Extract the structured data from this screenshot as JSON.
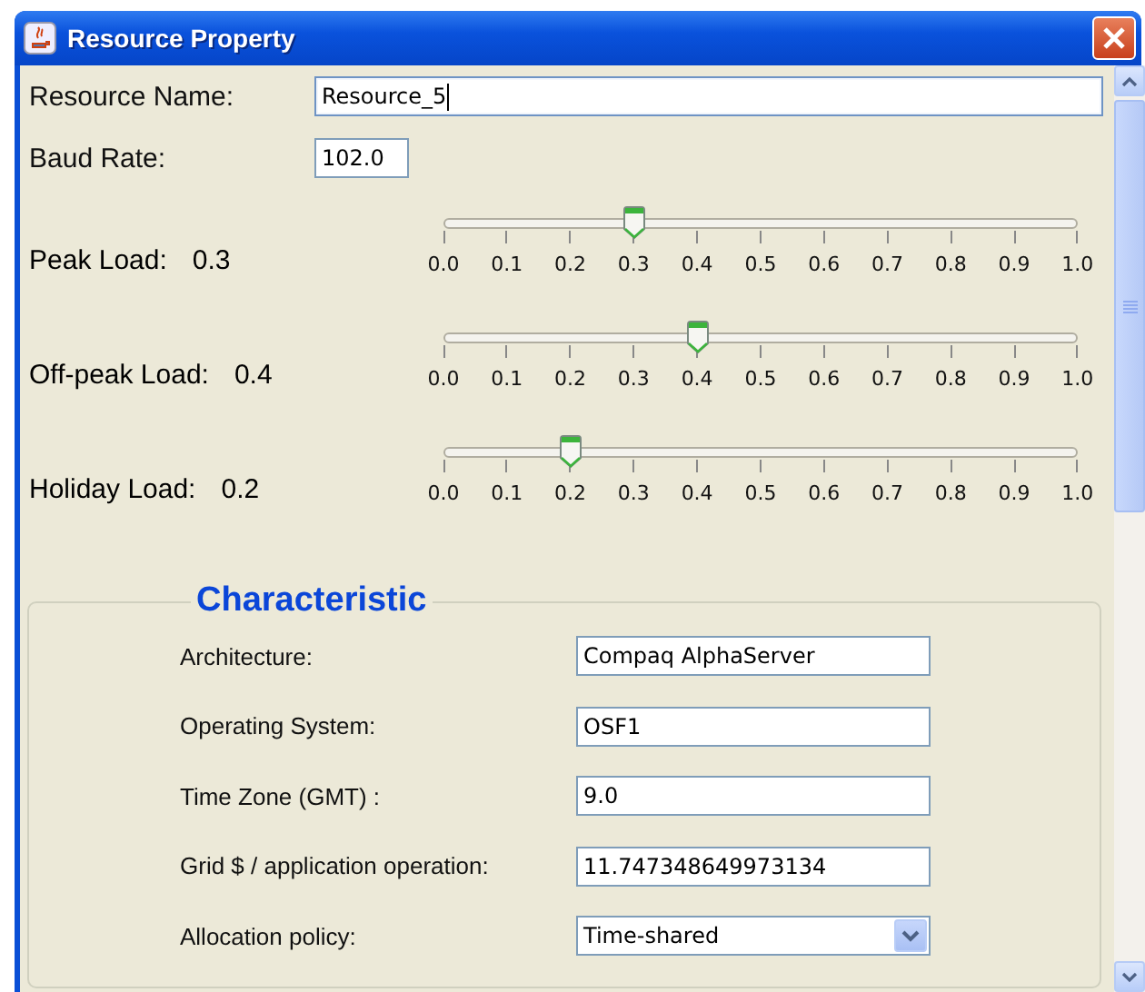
{
  "window": {
    "title": "Resource Property"
  },
  "fields": [
    {
      "label": "Resource Name:",
      "value": "Resource_5",
      "focused": true,
      "wide": true
    },
    {
      "label": "Baud Rate:",
      "value": "102.0",
      "focused": false,
      "wide": false
    }
  ],
  "sliders": [
    {
      "label": "Peak Load:",
      "reading": "0.3",
      "level": 0.3,
      "ticks": [
        "0.0",
        "0.1",
        "0.2",
        "0.3",
        "0.4",
        "0.5",
        "0.6",
        "0.7",
        "0.8",
        "0.9",
        "1.0"
      ]
    },
    {
      "label": "Off-peak Load:",
      "reading": "0.4",
      "level": 0.4,
      "ticks": [
        "0.0",
        "0.1",
        "0.2",
        "0.3",
        "0.4",
        "0.5",
        "0.6",
        "0.7",
        "0.8",
        "0.9",
        "1.0"
      ]
    },
    {
      "label": "Holiday Load:",
      "reading": "0.2",
      "level": 0.2,
      "ticks": [
        "0.0",
        "0.1",
        "0.2",
        "0.3",
        "0.4",
        "0.5",
        "0.6",
        "0.7",
        "0.8",
        "0.9",
        "1.0"
      ]
    }
  ],
  "characteristic": {
    "title": "Characteristic",
    "rows": [
      {
        "kind": "text",
        "label": "Architecture:",
        "value": "Compaq AlphaServer"
      },
      {
        "kind": "text",
        "label": "Operating System:",
        "value": "OSF1"
      },
      {
        "kind": "text",
        "label": "Time Zone (GMT) :",
        "value": "9.0"
      },
      {
        "kind": "text",
        "label": "Grid $ / application operation:",
        "value": "11.747348649973134"
      },
      {
        "kind": "combo",
        "label": "Allocation policy:",
        "value": "Time-shared"
      }
    ]
  }
}
